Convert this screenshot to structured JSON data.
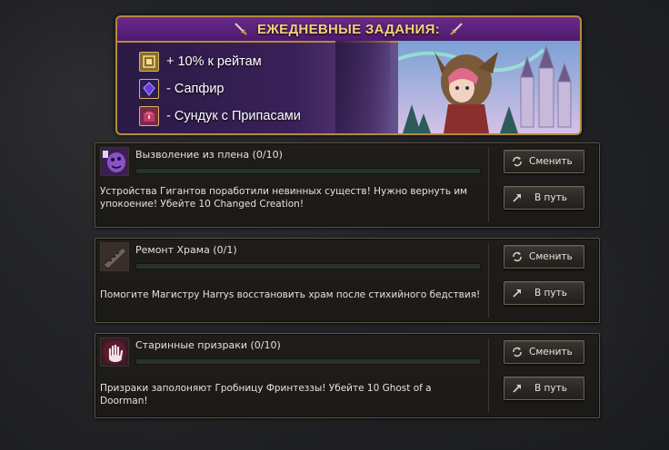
{
  "banner": {
    "title": "ЕЖЕДНЕВНЫЕ ЗАДАНИЯ:",
    "rewards": [
      {
        "icon": "rating-badge-icon",
        "text": "+ 10% к рейтам"
      },
      {
        "icon": "sapphire-gem-icon",
        "text": "- Сапфир"
      },
      {
        "icon": "supply-chest-icon",
        "text": "- Сундук с Припасами"
      }
    ]
  },
  "quests": [
    {
      "icon": "captive-creature-icon",
      "title": "Вызволение из плена (0/10)",
      "progress": 0,
      "description": "Устройства Гигантов поработили невинных существ! Нужно вернуть им упокоение! Убейте 10 Changed Creation!",
      "change_label": "Сменить",
      "go_label": "В путь"
    },
    {
      "icon": "temple-repair-icon",
      "title": "Ремонт Храма (0/1)",
      "progress": 0,
      "description": "Помогите Магистру Harrys восстановить храм после стихийного бедствия!",
      "change_label": "Сменить",
      "go_label": "В путь"
    },
    {
      "icon": "ghost-hand-icon",
      "title": "Старинные призраки (0/10)",
      "progress": 0,
      "description": "Призраки заполоняют Гробницу Фринтеззы! Убейте 10 Ghost of a Doorman!",
      "change_label": "Сменить",
      "go_label": "В путь"
    }
  ],
  "colors": {
    "banner_border": "#b78a3e",
    "banner_title": "#f4d27a",
    "panel_border": "#5c5446",
    "text": "#e7e2d6",
    "bar_bg": "#27322d"
  }
}
